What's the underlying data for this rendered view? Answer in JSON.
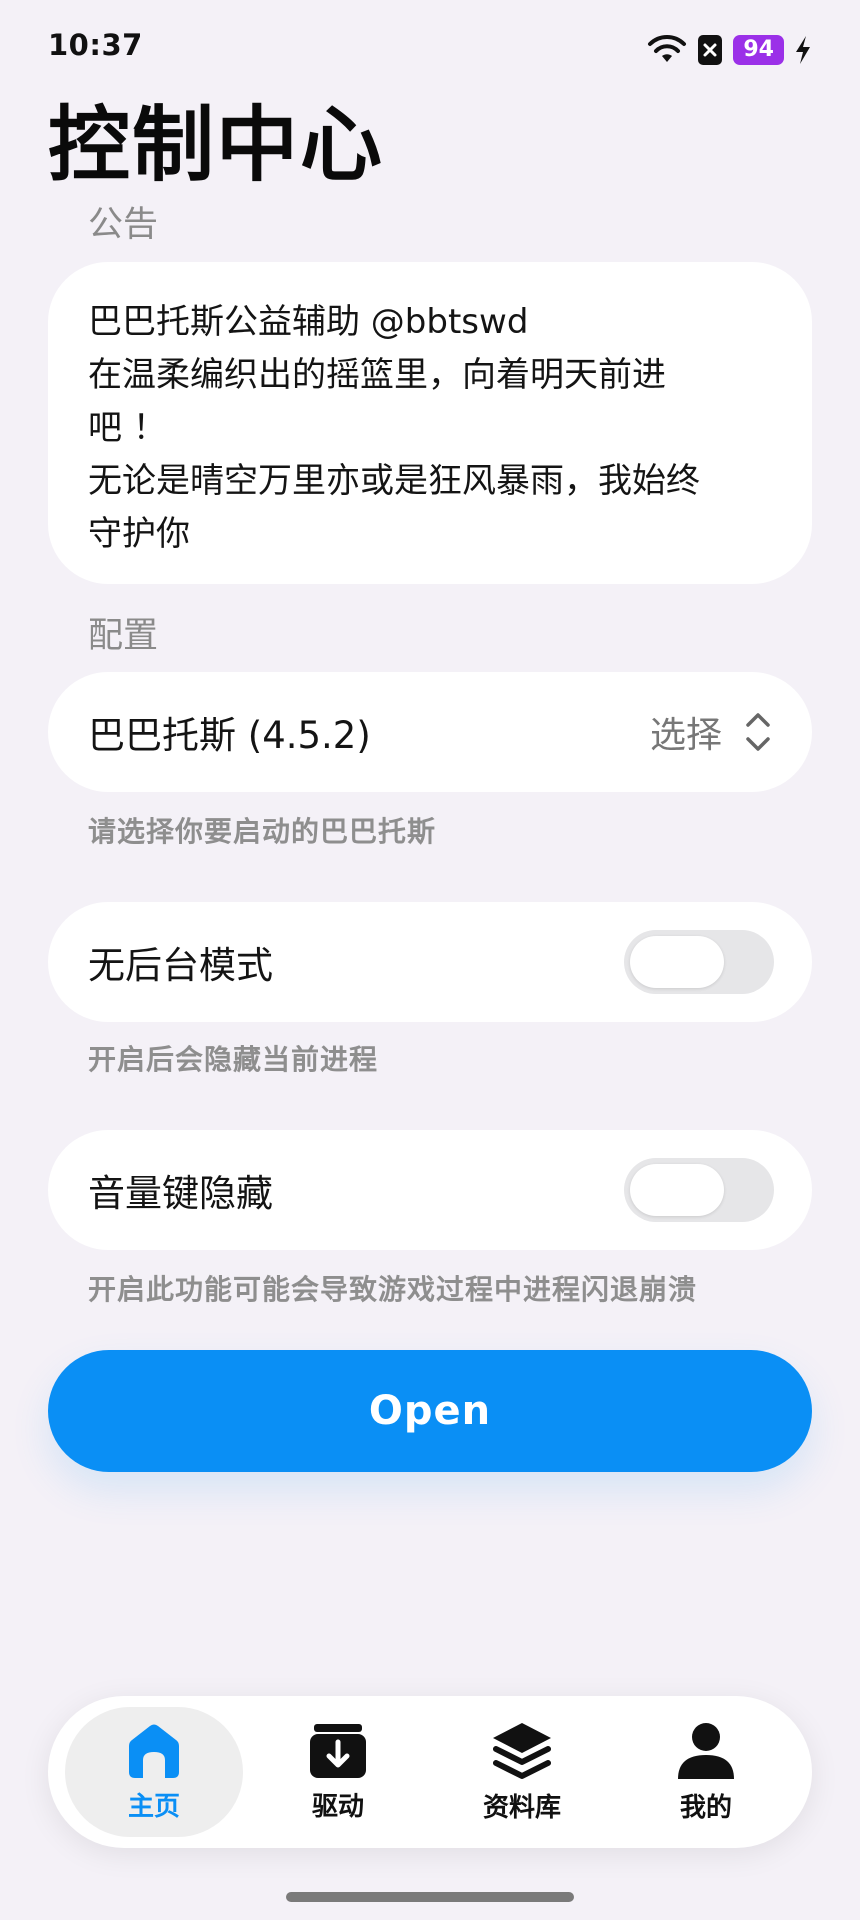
{
  "status_bar": {
    "time": "10:37",
    "battery": "94",
    "icons": [
      "wifi-icon",
      "x-badge-icon",
      "charging-bolt-icon"
    ]
  },
  "page_title": "控制中心",
  "notice": {
    "section_label": "公告",
    "lines": [
      "巴巴托斯公益辅助 @bbtswd",
      "在温柔编织出的摇篮里，向着明天前进",
      "吧 ！",
      "无论是晴空万里亦或是狂风暴雨，我始终",
      "守护你"
    ]
  },
  "config": {
    "section_label": "配置",
    "selected_value": "巴巴托斯 (4.5.2)",
    "select_label": "选择",
    "hint": "请选择你要启动的巴巴托斯"
  },
  "toggles": [
    {
      "label": "无后台模式",
      "enabled": false,
      "hint": "开启后会隐藏当前进程"
    },
    {
      "label": "音量键隐藏",
      "enabled": false,
      "hint": "开启此功能可能会导致游戏过程中进程闪退崩溃"
    }
  ],
  "open_button": {
    "label": "Open"
  },
  "colors": {
    "accent": "#0a8ff5",
    "background": "#f4f1f7",
    "battery_badge": "#9b30e8"
  },
  "bottom_nav": {
    "items": [
      {
        "label": "主页",
        "icon": "home-icon",
        "active": true
      },
      {
        "label": "驱动",
        "icon": "download-box-icon",
        "active": false
      },
      {
        "label": "资料库",
        "icon": "layers-icon",
        "active": false
      },
      {
        "label": "我的",
        "icon": "user-icon",
        "active": false
      }
    ]
  }
}
